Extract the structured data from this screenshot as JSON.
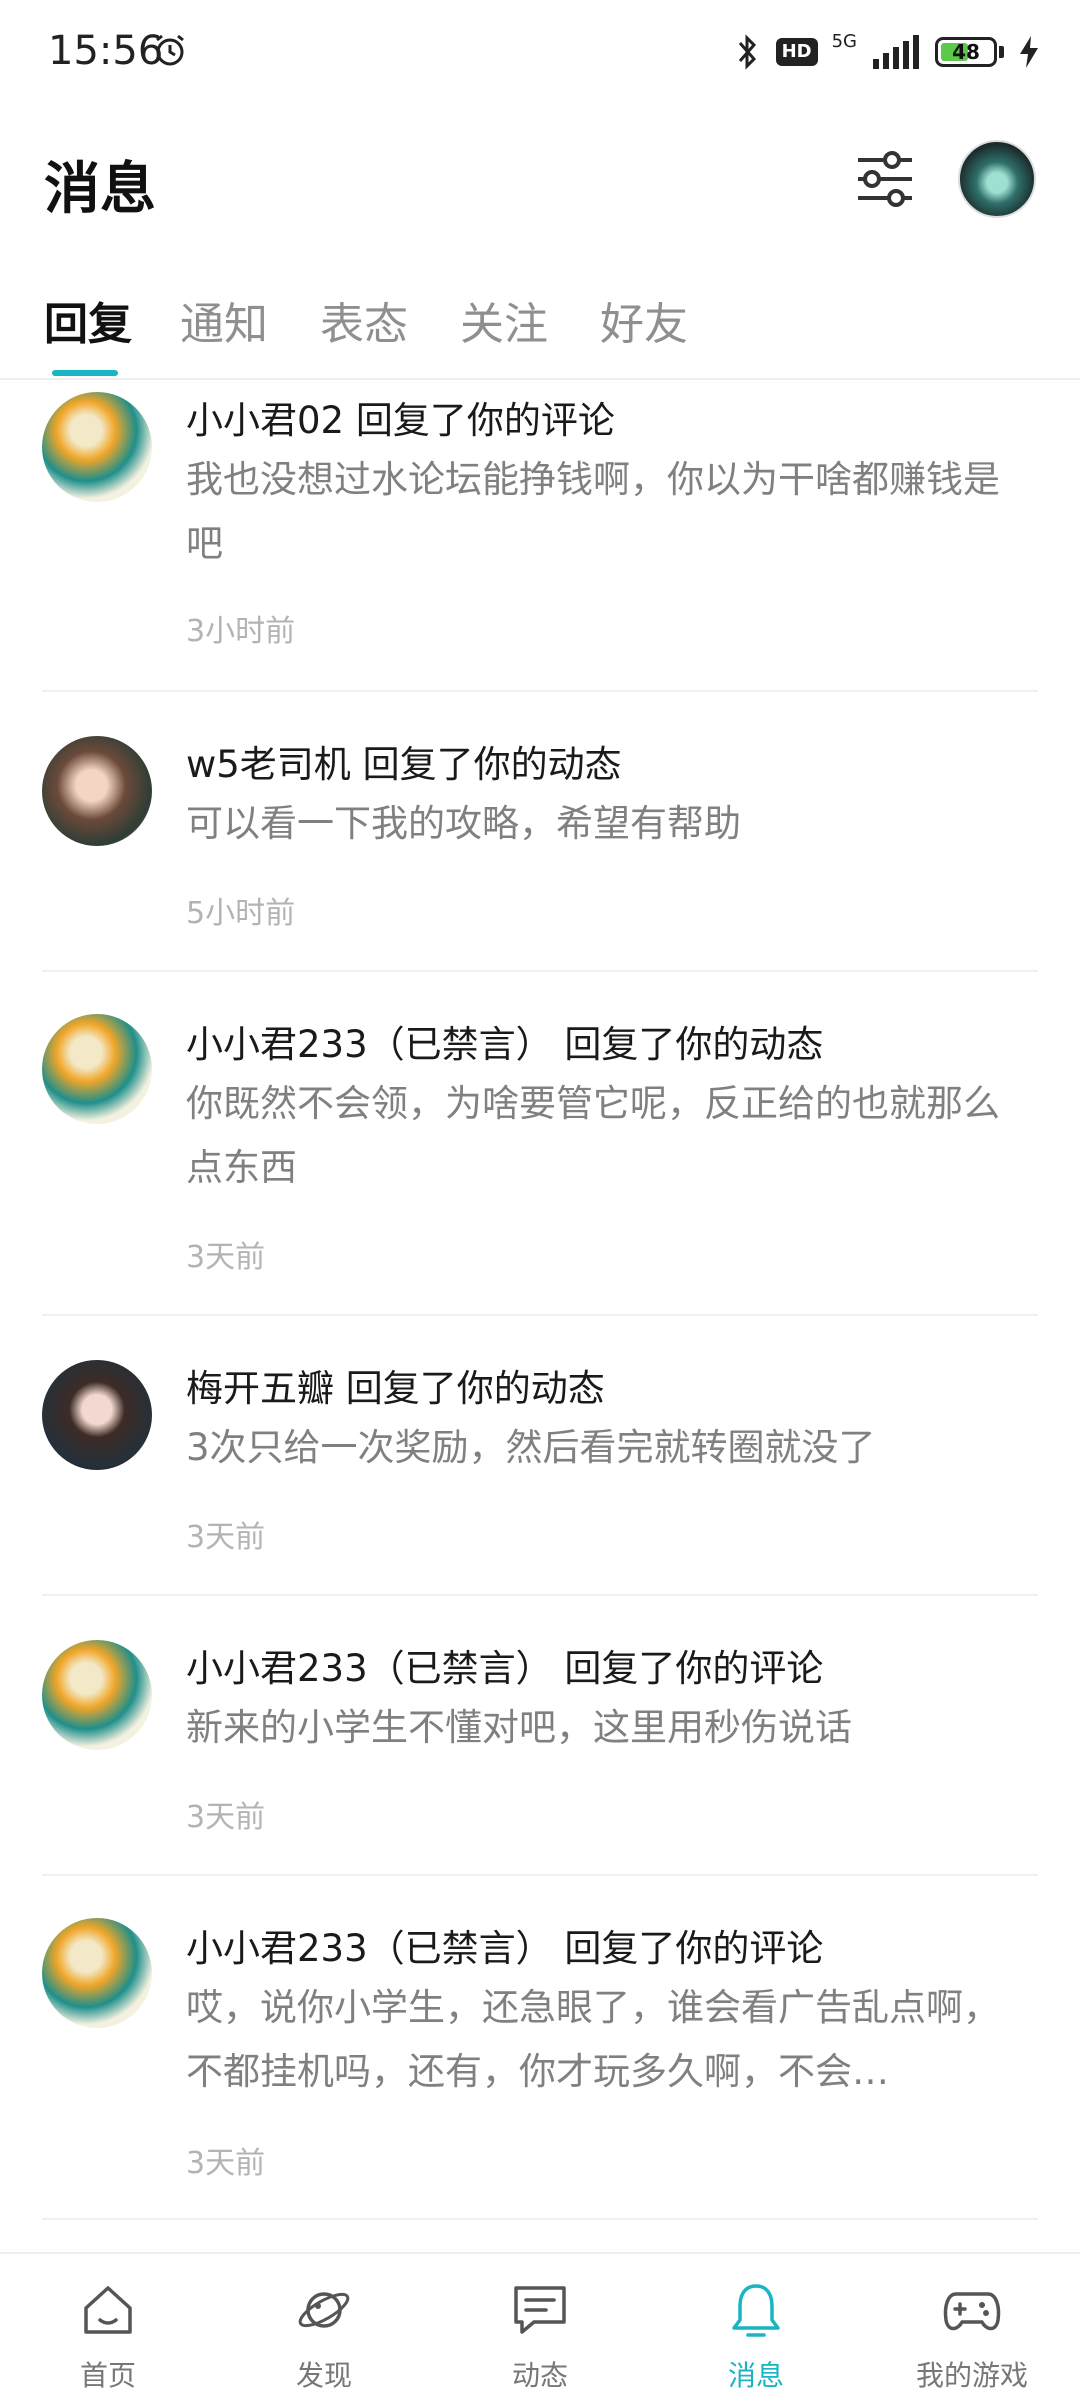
{
  "status_bar": {
    "time": "15:56",
    "network": "5G",
    "hd": "HD",
    "battery": "48"
  },
  "header": {
    "title": "消息"
  },
  "tabs": [
    {
      "label": "回复",
      "active": true
    },
    {
      "label": "通知",
      "active": false
    },
    {
      "label": "表态",
      "active": false
    },
    {
      "label": "关注",
      "active": false
    },
    {
      "label": "好友",
      "active": false
    }
  ],
  "messages": [
    {
      "title": "小小君02 回复了你的评论",
      "body": "我也没想过水论坛能挣钱啊，你以为干啥都赚钱是吧",
      "time": "3小时前"
    },
    {
      "title": "w5老司机 回复了你的动态",
      "body": "可以看一下我的攻略，希望有帮助",
      "time": "5小时前"
    },
    {
      "title": "小小君233（已禁言） 回复了你的动态",
      "body": "你既然不会领，为啥要管它呢，反正给的也就那么点东西",
      "time": "3天前"
    },
    {
      "title": "梅开五瓣 回复了你的动态",
      "body": "3次只给一次奖励，然后看完就转圈就没了",
      "time": "3天前"
    },
    {
      "title": "小小君233（已禁言） 回复了你的评论",
      "body": "新来的小学生不懂对吧，这里用秒伤说话",
      "time": "3天前"
    },
    {
      "title": "小小君233（已禁言） 回复了你的评论",
      "body": "哎，说你小学生，还急眼了，谁会看广告乱点啊，不都挂机吗，还有，你才玩多久啊，不会…",
      "time": "3天前"
    }
  ],
  "bottom_nav": [
    {
      "label": "首页",
      "icon": "home-icon",
      "active": false
    },
    {
      "label": "发现",
      "icon": "planet-icon",
      "active": false
    },
    {
      "label": "动态",
      "icon": "chat-icon",
      "active": false
    },
    {
      "label": "消息",
      "icon": "bell-icon",
      "active": true
    },
    {
      "label": "我的游戏",
      "icon": "gamepad-icon",
      "active": false
    }
  ],
  "colors": {
    "accent": "#19b5c3",
    "text_secondary": "#808080",
    "time_text": "#b3b3b3"
  }
}
